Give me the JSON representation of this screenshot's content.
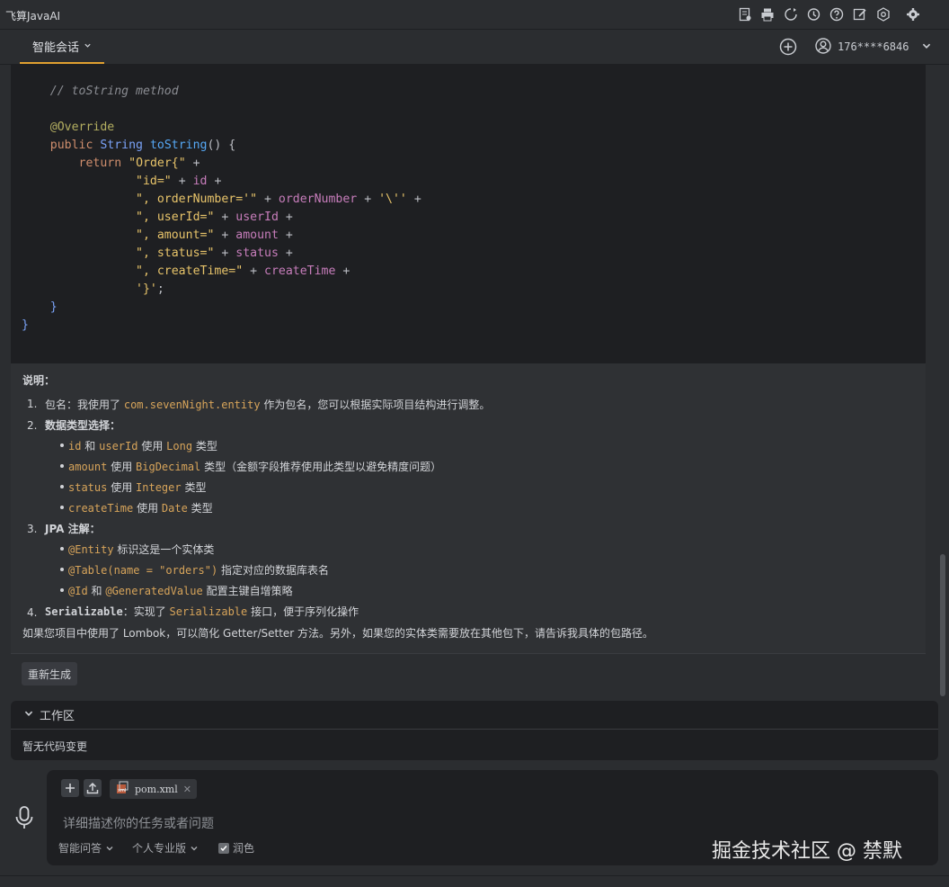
{
  "window": {
    "title": "飞算JavaAI"
  },
  "toolbar": {
    "icons": [
      "document-icon",
      "printer-icon",
      "sync-icon",
      "history-icon",
      "help-icon",
      "edit-icon",
      "settings-hex-icon",
      "gear-icon"
    ]
  },
  "tabs": {
    "active": "智能会话",
    "user": "176****6846"
  },
  "code": {
    "comment": "// toString method",
    "annotation": "@Override",
    "signature_kw": "public",
    "signature_type": "String",
    "signature_fn": "toString",
    "return_kw": "return"
  },
  "explanation": {
    "heading": "说明：",
    "item1_label": "包名：我使用了",
    "item1_code": "com.sevenNight.entity",
    "item1_rest": "作为包名，您可以根据实际项目结构进行调整。",
    "item2_label": "数据类型选择：",
    "item2_b1": {
      "a": "id",
      "b": "和",
      "c": "userId",
      "d": "使用",
      "e": "Long",
      "f": "类型"
    },
    "item2_b2": {
      "a": "amount",
      "b": "使用",
      "c": "BigDecimal",
      "d": "类型（金额字段推荐使用此类型以避免精度问题）"
    },
    "item2_b3": {
      "a": "status",
      "b": "使用",
      "c": "Integer",
      "d": "类型"
    },
    "item2_b4": {
      "a": "createTime",
      "b": "使用",
      "c": "Date",
      "d": "类型"
    },
    "item3_label": "JPA 注解：",
    "item3_b1": {
      "a": "@Entity",
      "b": "标识这是一个实体类"
    },
    "item3_b2": {
      "a": "@Table(name = \"orders\")",
      "b": "指定对应的数据库表名"
    },
    "item3_b3": {
      "a": "@Id",
      "b": "和",
      "c": "@GeneratedValue",
      "d": "配置主键自增策略"
    },
    "item4_label": "Serializable",
    "item4_rest1": "：实现了",
    "item4_code": "Serializable",
    "item4_rest2": "接口，便于序列化操作",
    "footer": "如果您项目中使用了 Lombok，可以简化 Getter/Setter 方法。另外，如果您的实体类需要放在其他包下，请告诉我具体的包路径。",
    "regen": "重新生成"
  },
  "workspace": {
    "title": "工作区",
    "empty": "暂无代码变更"
  },
  "input": {
    "file": "pom.xml",
    "placeholder": "详细描述你的任务或者问题",
    "mode": "智能问答",
    "edition": "个人专业版",
    "polish": "润色"
  },
  "watermark": "掘金技术社区 @ 禁默",
  "colors": {
    "accent": "#e0a030",
    "code_bg": "#1e1f22",
    "panel_bg": "#2b2d30"
  }
}
